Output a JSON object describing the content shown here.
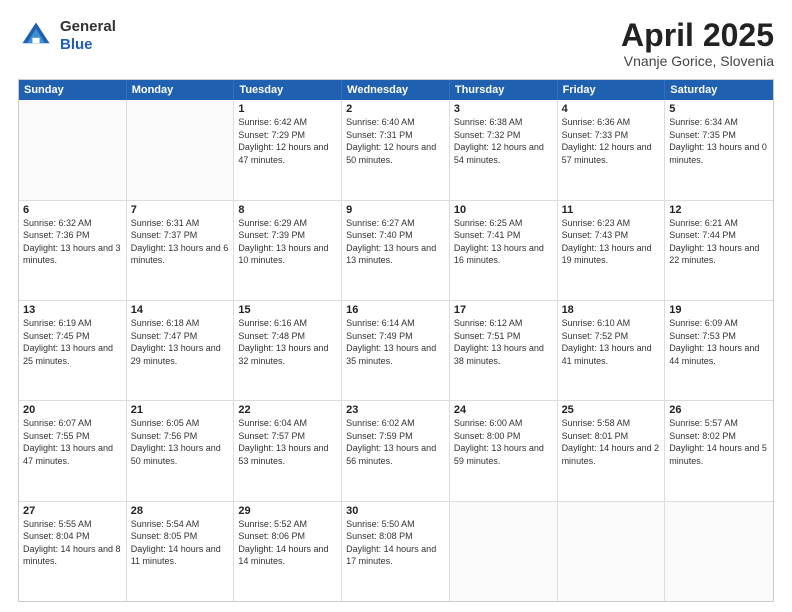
{
  "header": {
    "logo": {
      "line1": "General",
      "line2": "Blue"
    },
    "title": "April 2025",
    "location": "Vnanje Gorice, Slovenia"
  },
  "weekdays": [
    "Sunday",
    "Monday",
    "Tuesday",
    "Wednesday",
    "Thursday",
    "Friday",
    "Saturday"
  ],
  "weeks": [
    [
      {
        "day": "",
        "sunrise": "",
        "sunset": "",
        "daylight": ""
      },
      {
        "day": "",
        "sunrise": "",
        "sunset": "",
        "daylight": ""
      },
      {
        "day": "1",
        "sunrise": "Sunrise: 6:42 AM",
        "sunset": "Sunset: 7:29 PM",
        "daylight": "Daylight: 12 hours and 47 minutes."
      },
      {
        "day": "2",
        "sunrise": "Sunrise: 6:40 AM",
        "sunset": "Sunset: 7:31 PM",
        "daylight": "Daylight: 12 hours and 50 minutes."
      },
      {
        "day": "3",
        "sunrise": "Sunrise: 6:38 AM",
        "sunset": "Sunset: 7:32 PM",
        "daylight": "Daylight: 12 hours and 54 minutes."
      },
      {
        "day": "4",
        "sunrise": "Sunrise: 6:36 AM",
        "sunset": "Sunset: 7:33 PM",
        "daylight": "Daylight: 12 hours and 57 minutes."
      },
      {
        "day": "5",
        "sunrise": "Sunrise: 6:34 AM",
        "sunset": "Sunset: 7:35 PM",
        "daylight": "Daylight: 13 hours and 0 minutes."
      }
    ],
    [
      {
        "day": "6",
        "sunrise": "Sunrise: 6:32 AM",
        "sunset": "Sunset: 7:36 PM",
        "daylight": "Daylight: 13 hours and 3 minutes."
      },
      {
        "day": "7",
        "sunrise": "Sunrise: 6:31 AM",
        "sunset": "Sunset: 7:37 PM",
        "daylight": "Daylight: 13 hours and 6 minutes."
      },
      {
        "day": "8",
        "sunrise": "Sunrise: 6:29 AM",
        "sunset": "Sunset: 7:39 PM",
        "daylight": "Daylight: 13 hours and 10 minutes."
      },
      {
        "day": "9",
        "sunrise": "Sunrise: 6:27 AM",
        "sunset": "Sunset: 7:40 PM",
        "daylight": "Daylight: 13 hours and 13 minutes."
      },
      {
        "day": "10",
        "sunrise": "Sunrise: 6:25 AM",
        "sunset": "Sunset: 7:41 PM",
        "daylight": "Daylight: 13 hours and 16 minutes."
      },
      {
        "day": "11",
        "sunrise": "Sunrise: 6:23 AM",
        "sunset": "Sunset: 7:43 PM",
        "daylight": "Daylight: 13 hours and 19 minutes."
      },
      {
        "day": "12",
        "sunrise": "Sunrise: 6:21 AM",
        "sunset": "Sunset: 7:44 PM",
        "daylight": "Daylight: 13 hours and 22 minutes."
      }
    ],
    [
      {
        "day": "13",
        "sunrise": "Sunrise: 6:19 AM",
        "sunset": "Sunset: 7:45 PM",
        "daylight": "Daylight: 13 hours and 25 minutes."
      },
      {
        "day": "14",
        "sunrise": "Sunrise: 6:18 AM",
        "sunset": "Sunset: 7:47 PM",
        "daylight": "Daylight: 13 hours and 29 minutes."
      },
      {
        "day": "15",
        "sunrise": "Sunrise: 6:16 AM",
        "sunset": "Sunset: 7:48 PM",
        "daylight": "Daylight: 13 hours and 32 minutes."
      },
      {
        "day": "16",
        "sunrise": "Sunrise: 6:14 AM",
        "sunset": "Sunset: 7:49 PM",
        "daylight": "Daylight: 13 hours and 35 minutes."
      },
      {
        "day": "17",
        "sunrise": "Sunrise: 6:12 AM",
        "sunset": "Sunset: 7:51 PM",
        "daylight": "Daylight: 13 hours and 38 minutes."
      },
      {
        "day": "18",
        "sunrise": "Sunrise: 6:10 AM",
        "sunset": "Sunset: 7:52 PM",
        "daylight": "Daylight: 13 hours and 41 minutes."
      },
      {
        "day": "19",
        "sunrise": "Sunrise: 6:09 AM",
        "sunset": "Sunset: 7:53 PM",
        "daylight": "Daylight: 13 hours and 44 minutes."
      }
    ],
    [
      {
        "day": "20",
        "sunrise": "Sunrise: 6:07 AM",
        "sunset": "Sunset: 7:55 PM",
        "daylight": "Daylight: 13 hours and 47 minutes."
      },
      {
        "day": "21",
        "sunrise": "Sunrise: 6:05 AM",
        "sunset": "Sunset: 7:56 PM",
        "daylight": "Daylight: 13 hours and 50 minutes."
      },
      {
        "day": "22",
        "sunrise": "Sunrise: 6:04 AM",
        "sunset": "Sunset: 7:57 PM",
        "daylight": "Daylight: 13 hours and 53 minutes."
      },
      {
        "day": "23",
        "sunrise": "Sunrise: 6:02 AM",
        "sunset": "Sunset: 7:59 PM",
        "daylight": "Daylight: 13 hours and 56 minutes."
      },
      {
        "day": "24",
        "sunrise": "Sunrise: 6:00 AM",
        "sunset": "Sunset: 8:00 PM",
        "daylight": "Daylight: 13 hours and 59 minutes."
      },
      {
        "day": "25",
        "sunrise": "Sunrise: 5:58 AM",
        "sunset": "Sunset: 8:01 PM",
        "daylight": "Daylight: 14 hours and 2 minutes."
      },
      {
        "day": "26",
        "sunrise": "Sunrise: 5:57 AM",
        "sunset": "Sunset: 8:02 PM",
        "daylight": "Daylight: 14 hours and 5 minutes."
      }
    ],
    [
      {
        "day": "27",
        "sunrise": "Sunrise: 5:55 AM",
        "sunset": "Sunset: 8:04 PM",
        "daylight": "Daylight: 14 hours and 8 minutes."
      },
      {
        "day": "28",
        "sunrise": "Sunrise: 5:54 AM",
        "sunset": "Sunset: 8:05 PM",
        "daylight": "Daylight: 14 hours and 11 minutes."
      },
      {
        "day": "29",
        "sunrise": "Sunrise: 5:52 AM",
        "sunset": "Sunset: 8:06 PM",
        "daylight": "Daylight: 14 hours and 14 minutes."
      },
      {
        "day": "30",
        "sunrise": "Sunrise: 5:50 AM",
        "sunset": "Sunset: 8:08 PM",
        "daylight": "Daylight: 14 hours and 17 minutes."
      },
      {
        "day": "",
        "sunrise": "",
        "sunset": "",
        "daylight": ""
      },
      {
        "day": "",
        "sunrise": "",
        "sunset": "",
        "daylight": ""
      },
      {
        "day": "",
        "sunrise": "",
        "sunset": "",
        "daylight": ""
      }
    ]
  ]
}
